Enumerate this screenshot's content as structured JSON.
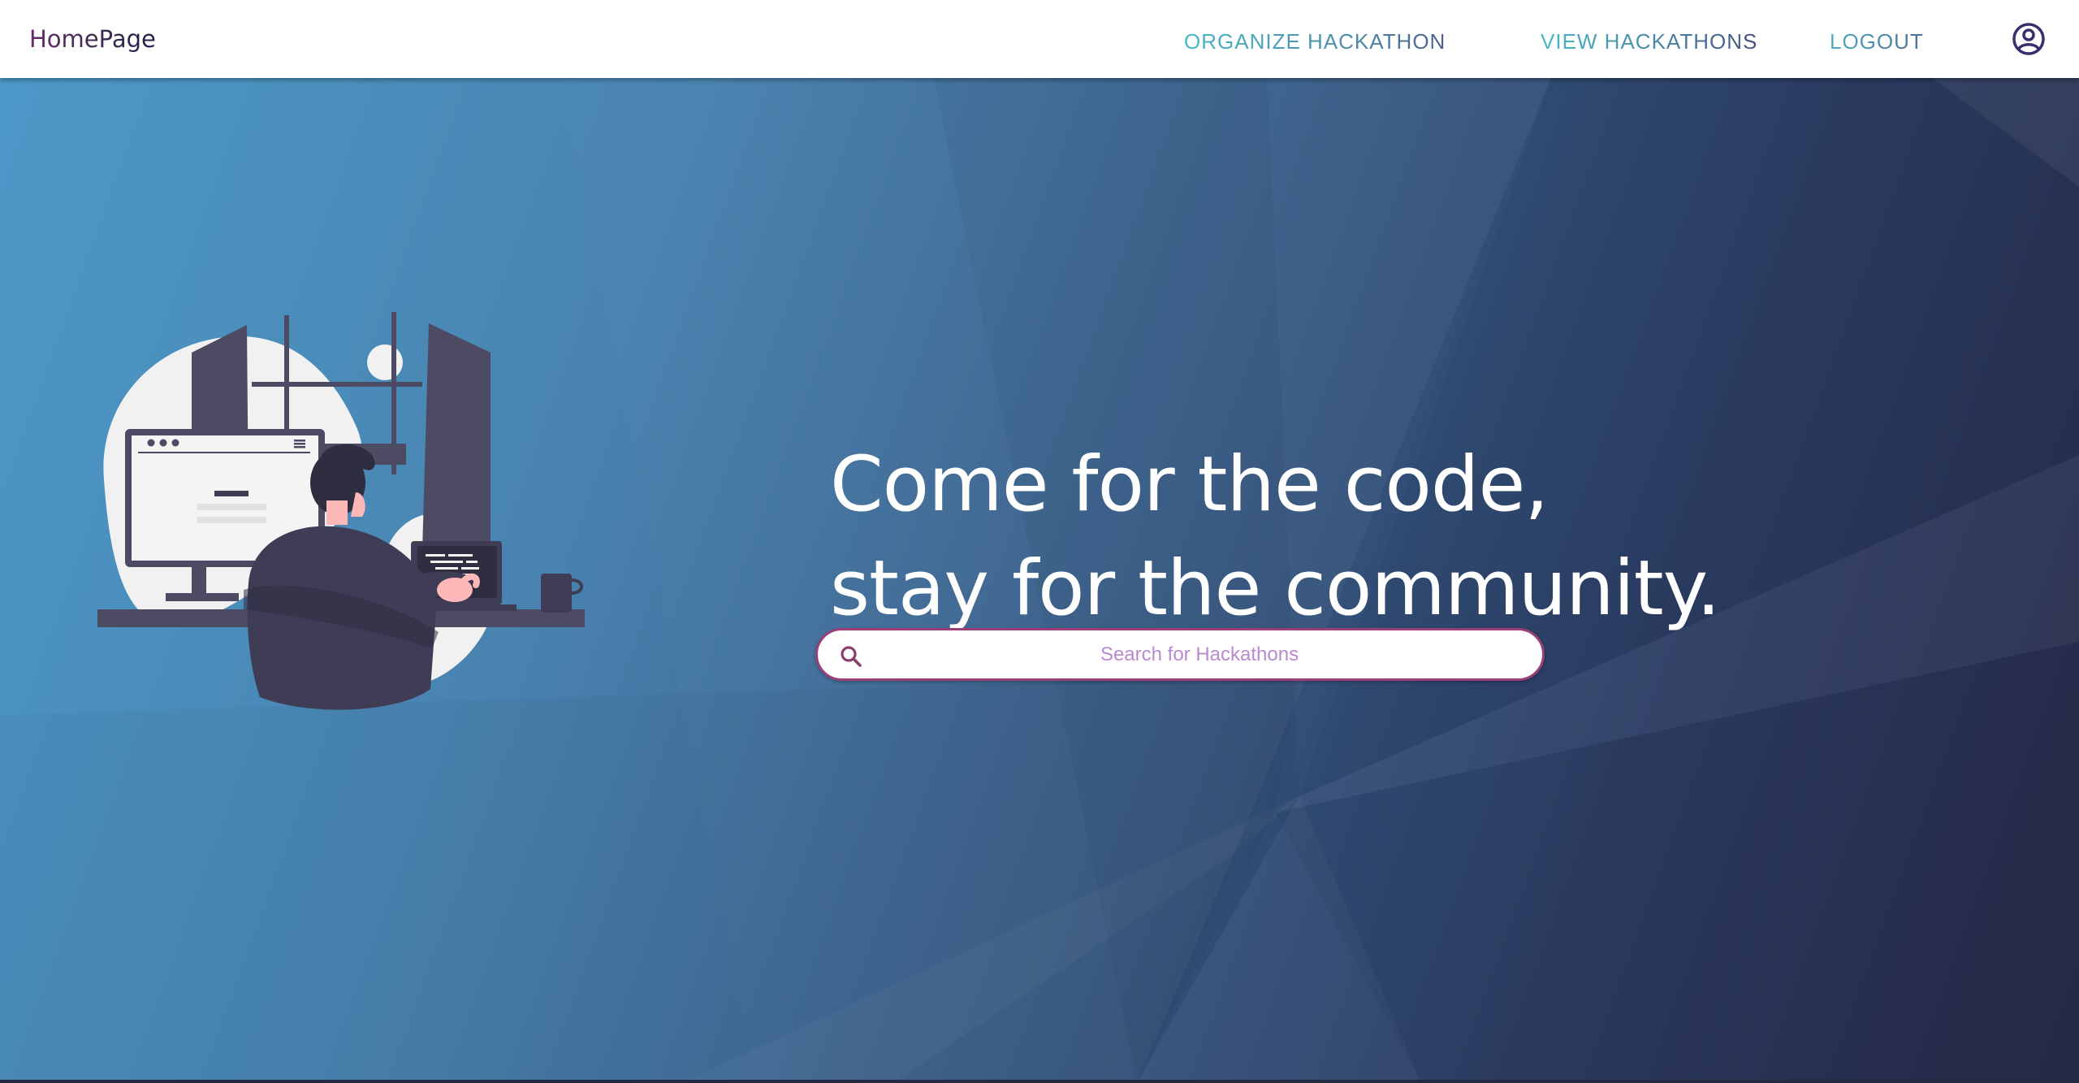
{
  "navbar": {
    "brand": "HomePage",
    "links": [
      {
        "label": "ORGANIZE HACKATHON"
      },
      {
        "label": "VIEW HACKATHONS"
      },
      {
        "label": "LOGOUT"
      }
    ],
    "account_icon": "account-circle-icon"
  },
  "hero": {
    "headline_line1": "Come for the code,",
    "headline_line2": "stay for the community.",
    "illustration": "developer-at-desk-illustration",
    "search": {
      "placeholder": "Search for Hackathons",
      "value": "",
      "icon": "search-icon"
    }
  },
  "colors": {
    "background_start": "#4696c7",
    "background_end": "#272a47",
    "search_border": "#9a3f78",
    "placeholder": "#b98ad0",
    "nav_link": "#4fb1c2",
    "brand": "#3d2b52"
  }
}
